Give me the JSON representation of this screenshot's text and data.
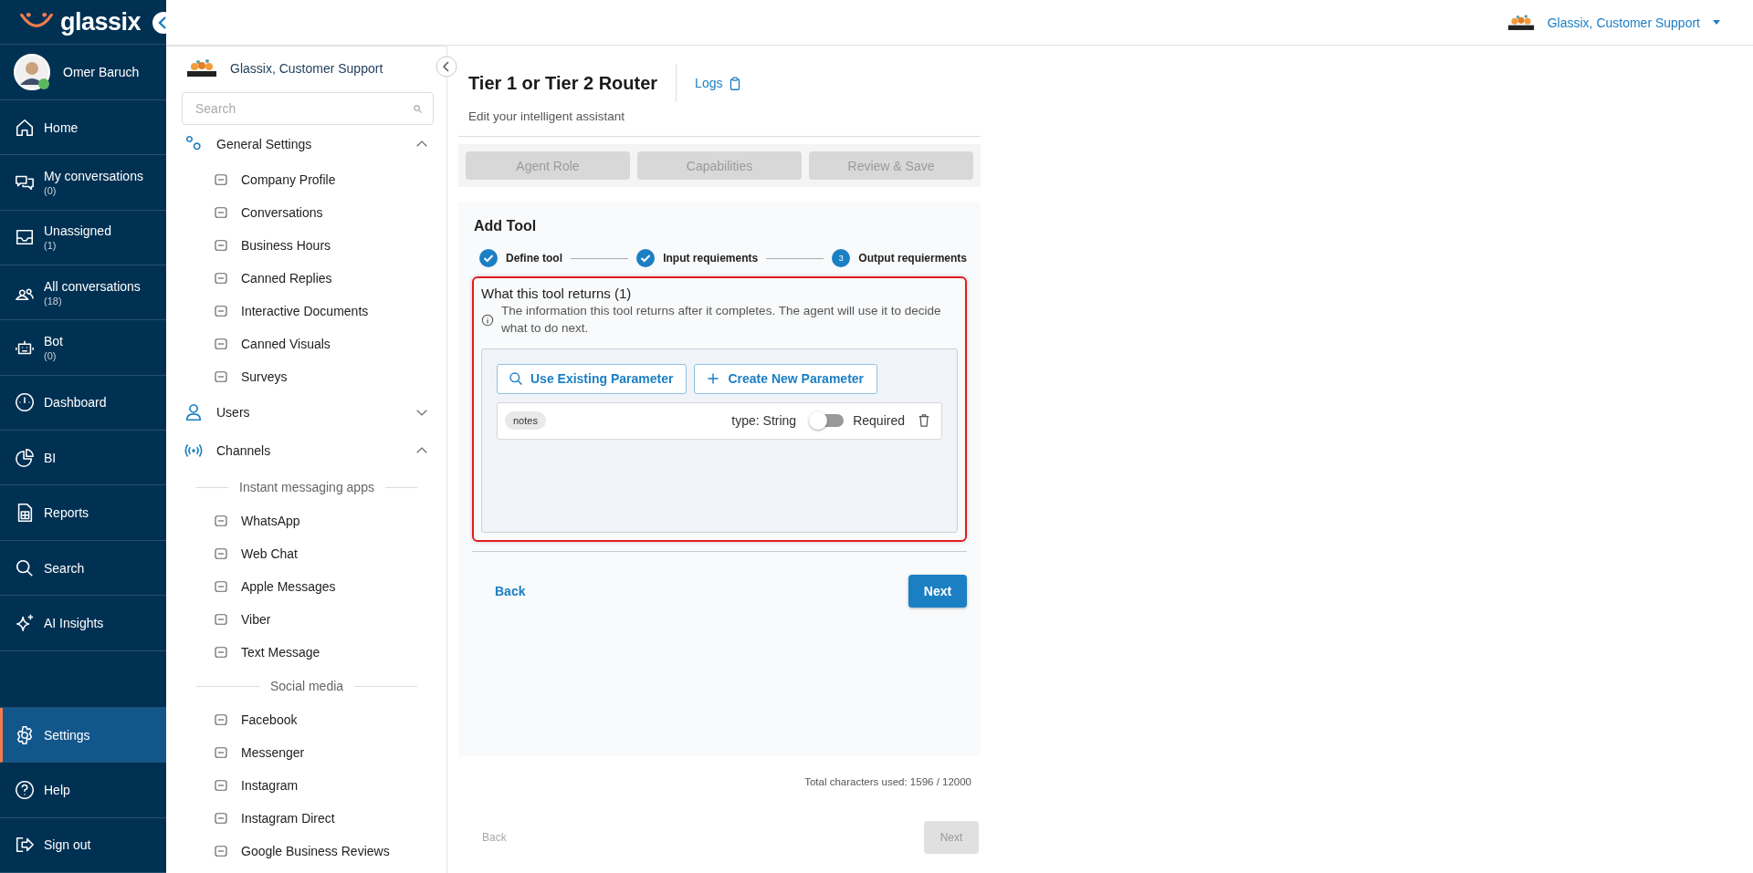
{
  "brand": {
    "name": "glassix"
  },
  "account": {
    "name": "Glassix, Customer Support"
  },
  "user": {
    "name": "Omer Baruch",
    "online": true
  },
  "nav": {
    "main": [
      {
        "label": "Home",
        "selected": false
      },
      {
        "label": "My conversations",
        "count": "(0)",
        "selected": false
      },
      {
        "label": "Unassigned",
        "count": "(1)",
        "selected": false
      },
      {
        "label": "All conversations",
        "count": "(18)",
        "selected": false
      },
      {
        "label": "Bot",
        "count": "(0)",
        "selected": false
      },
      {
        "label": "Dashboard",
        "selected": false
      },
      {
        "label": "BI",
        "selected": false
      },
      {
        "label": "Reports",
        "selected": false
      },
      {
        "label": "Search",
        "selected": false
      },
      {
        "label": "AI Insights",
        "selected": false
      }
    ],
    "bottom": [
      {
        "label": "Settings",
        "selected": true
      },
      {
        "label": "Help",
        "selected": false
      },
      {
        "label": "Sign out",
        "selected": false
      }
    ]
  },
  "settings_menu": {
    "org": "Glassix, Customer Support",
    "search": {
      "placeholder": "Search"
    },
    "sections": [
      {
        "label": "General Settings",
        "expanded": true,
        "children": [
          {
            "kind": "link",
            "label": "Company Profile"
          },
          {
            "kind": "link",
            "label": "Conversations"
          },
          {
            "kind": "link",
            "label": "Business Hours"
          },
          {
            "kind": "link",
            "label": "Canned Replies"
          },
          {
            "kind": "link",
            "label": "Interactive Documents"
          },
          {
            "kind": "link",
            "label": "Canned Visuals"
          },
          {
            "kind": "link",
            "label": "Surveys"
          }
        ]
      },
      {
        "label": "Users",
        "expanded": false
      },
      {
        "label": "Channels",
        "expanded": true,
        "children": [
          {
            "kind": "heading",
            "label": "Instant messaging apps"
          },
          {
            "kind": "link",
            "label": "WhatsApp"
          },
          {
            "kind": "link",
            "label": "Web Chat"
          },
          {
            "kind": "link",
            "label": "Apple Messages"
          },
          {
            "kind": "link",
            "label": "Viber"
          },
          {
            "kind": "link",
            "label": "Text Message"
          },
          {
            "kind": "heading",
            "label": "Social media"
          },
          {
            "kind": "link",
            "label": "Facebook"
          },
          {
            "kind": "link",
            "label": "Messenger"
          },
          {
            "kind": "link",
            "label": "Instagram"
          },
          {
            "kind": "link",
            "label": "Instagram Direct"
          },
          {
            "kind": "link",
            "label": "Google Business Reviews"
          }
        ]
      }
    ]
  },
  "page": {
    "title": "Tier 1 or Tier 2 Router",
    "logs": "Logs",
    "subtitle": "Edit your intelligent assistant",
    "tabs": [
      {
        "label": "Agent Role",
        "disabled": true
      },
      {
        "label": "Capabilities",
        "disabled": true
      },
      {
        "label": "Review & Save",
        "disabled": true
      }
    ]
  },
  "add_tool": {
    "title": "Add Tool",
    "steps": [
      {
        "label": "Define tool",
        "done": true
      },
      {
        "label": "Input requiements",
        "done": true
      },
      {
        "label": "Output requierments",
        "done": false,
        "number": "3"
      }
    ],
    "outputs": {
      "highlighted": true,
      "title": "What this tool returns (1)",
      "info": "The information this tool returns after it completes. The agent will use it to decide what to do next.",
      "use_existing": "Use Existing Parameter",
      "create_new": "Create New Parameter",
      "parameters": [
        {
          "name": "notes",
          "type": "type: String",
          "required": false,
          "required_label": "Required"
        }
      ]
    },
    "back": "Back",
    "next": "Next"
  },
  "footer": {
    "total": "Total characters used: 1596 / 12000",
    "back": {
      "label": "Back",
      "disabled": true
    },
    "next": {
      "label": "Next",
      "disabled": true
    }
  }
}
